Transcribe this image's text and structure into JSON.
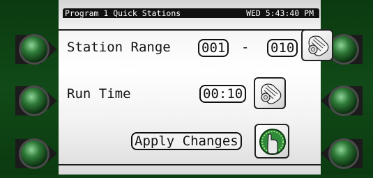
{
  "header": {
    "title": "Program 1 Quick Stations",
    "datetime": "WED 5:43:40 PM"
  },
  "station_range": {
    "label": "Station Range",
    "start": "001",
    "separator": "-",
    "end": "010"
  },
  "run_time": {
    "label": "Run Time",
    "value": "00:10"
  },
  "apply": {
    "label": "Apply Changes"
  },
  "icons": {
    "dial": "hand-dial-icon",
    "apply": "finger-press-icon",
    "side": "round-green-button-icon"
  },
  "colors": {
    "bezel": "#0d3d12",
    "screen": "#ffffff",
    "ink": "#111111",
    "button_green": "#2f7a38"
  }
}
